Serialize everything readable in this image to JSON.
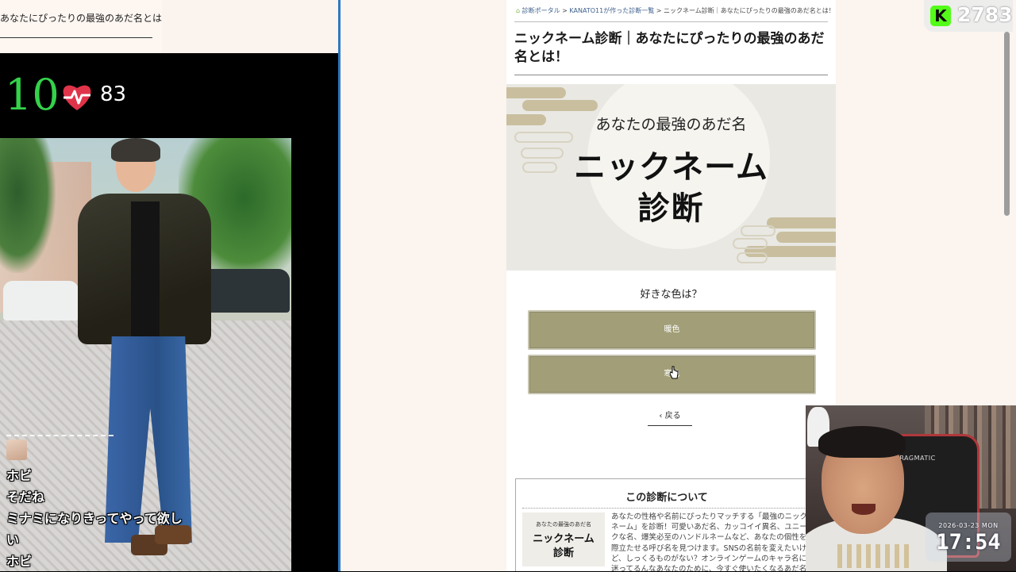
{
  "left_panel": {
    "page_title_fragment": "あなたにぴったりの最強のあだ名とは！",
    "counter": "10",
    "heart_rate": "83",
    "chat": {
      "lines": [
        "ホビ",
        "そだね",
        "ミナミになりきってやって欲し",
        "い",
        "ホビ"
      ]
    }
  },
  "browser": {
    "breadcrumb": {
      "home": "診断ポータル",
      "sep1": ">",
      "parent": "KANATO11が作った診断一覧",
      "sep2": ">",
      "current": "ニックネーム診断｜あなたにぴったりの最強のあだ名とは！"
    },
    "title": "ニックネーム診断｜あなたにぴったりの最強のあだ名とは！",
    "hero": {
      "subtitle": "あなたの最強のあだ名",
      "title_line1": "ニックネーム",
      "title_line2": "診断"
    },
    "question": "好きな色は？",
    "answers": [
      "暖色",
      "寒色"
    ],
    "back_label": "戻る",
    "about": {
      "title": "この診断について",
      "thumb_sub": "あなたの最強のあだ名",
      "thumb_line1": "ニックネーム",
      "thumb_line2": "診断",
      "text": "あなたの性格や名前にぴったりマッチする「最強のニックネーム」を診断！可愛いあだ名、カッコイイ異名、ユニークな名、爆笑必至のハンドルネームなど、あなたの個性を際立たせる呼び名を見つけます。SNSの名前を変えたいけど、しっくるものがない？オンラインゲームのキャラ名に迷ってるんなあなたのために、今すぐ使いたくなるあだ名をご提案"
    }
  },
  "overlay": {
    "viewer_icon": "K",
    "viewer_count": "2783",
    "webcam_chair_label": "PRAGMATIC",
    "clock_date": "2026-03-23 MON",
    "clock_time": "17:54"
  },
  "colors": {
    "counter_green": "#34d24a",
    "heart_red": "#e0344a",
    "answer_button": "#a29f78",
    "divider_blue": "#2b78c4",
    "kick_green": "#53fc18"
  }
}
